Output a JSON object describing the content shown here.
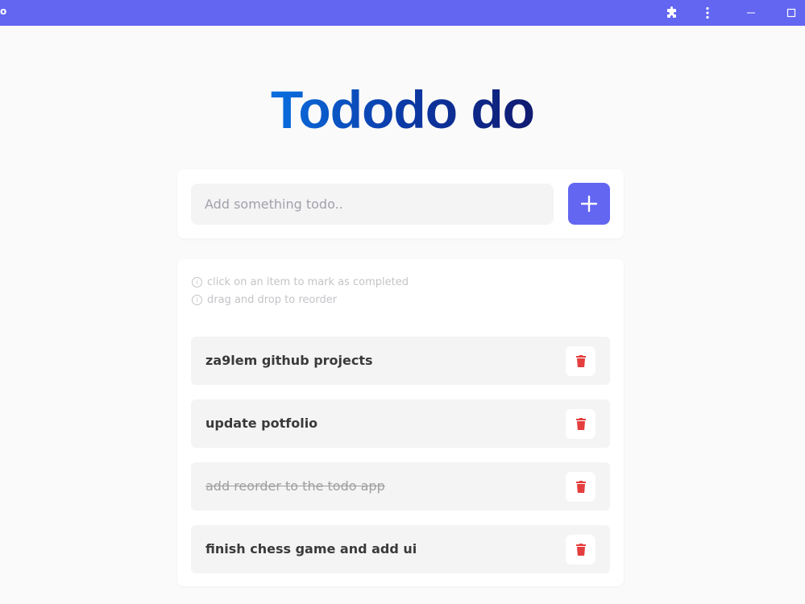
{
  "window": {
    "title": "o",
    "icons": [
      "puzzle-icon",
      "kebab-menu-icon",
      "minimize-icon",
      "maximize-icon"
    ],
    "bar_color": "#6366f1"
  },
  "app": {
    "logo": "Tododo do",
    "accent": "#6366f1"
  },
  "input": {
    "placeholder": "Add something todo..",
    "value": "",
    "add_icon": "plus-icon"
  },
  "hints": [
    {
      "icon": "info-icon",
      "text": "click on an item to mark as completed"
    },
    {
      "icon": "info-icon",
      "text": "drag and drop to reorder"
    }
  ],
  "todos": [
    {
      "text": "za9lem github projects",
      "completed": false,
      "delete_icon": "trash-icon"
    },
    {
      "text": "update potfolio",
      "completed": false,
      "delete_icon": "trash-icon"
    },
    {
      "text": "add reorder to the todo app",
      "completed": true,
      "delete_icon": "trash-icon"
    },
    {
      "text": "finish chess game and add ui",
      "completed": false,
      "delete_icon": "trash-icon"
    }
  ],
  "colors": {
    "delete": "#e53e3e",
    "item_bg": "#f4f4f5"
  }
}
